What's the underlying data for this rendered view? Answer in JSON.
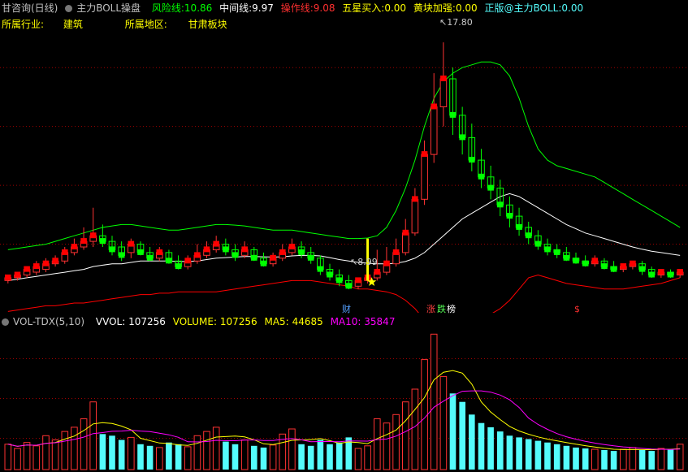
{
  "top_bar": {
    "stock": "甘咨询(日线)",
    "indicator": "主力BOLL操盘",
    "risk_label": "风险线:",
    "risk_value": "10.86",
    "mid_label": "中间线:",
    "mid_value": "9.97",
    "op_label": "操作线:",
    "op_value": "9.08",
    "five_label": "五星买入:",
    "five_value": "0.00",
    "yellow_label": "黄块加强:",
    "yellow_value": "0.00",
    "brand": "正版@主力BOLL:",
    "brand_value": "0.00"
  },
  "info_bar": {
    "industry_label": "所属行业:",
    "industry_value": "建筑",
    "region_label": "所属地区:",
    "region_value": "甘肃板块"
  },
  "annotations": {
    "high_label": "17.80",
    "low_label": "8.99",
    "markers": [
      "财",
      "涨",
      "跌",
      "榜",
      "$"
    ]
  },
  "volume_bar": {
    "name": "VOL-TDX(5,10)",
    "vvol_label": "VVOL:",
    "vvol_value": "107256",
    "volume_label": "VOLUME:",
    "volume_value": "107256",
    "ma5_label": "MA5:",
    "ma5_value": "44685",
    "ma10_label": "MA10:",
    "ma10_value": "35847"
  },
  "colors": {
    "up": "#ff3232",
    "down": "#54fcfc",
    "green": "#00ff00",
    "red": "#ff0000",
    "yellow": "#ffff00",
    "magenta": "#ff00ff",
    "white": "#ffffff",
    "grid": "#a00000"
  },
  "chart_data": {
    "type": "candlestick",
    "price_axis_range": [
      8.5,
      18.5
    ],
    "high": 17.8,
    "low": 8.99,
    "bars": [
      {
        "o": 9.3,
        "c": 9.4,
        "h": 9.5,
        "l": 9.2,
        "v": 30000
      },
      {
        "o": 9.4,
        "c": 9.5,
        "h": 9.6,
        "l": 9.3,
        "v": 25000
      },
      {
        "o": 9.5,
        "c": 9.7,
        "h": 9.8,
        "l": 9.4,
        "v": 32000
      },
      {
        "o": 9.6,
        "c": 9.8,
        "h": 10.0,
        "l": 9.5,
        "v": 28000
      },
      {
        "o": 9.7,
        "c": 9.9,
        "h": 10.1,
        "l": 9.6,
        "v": 40000
      },
      {
        "o": 9.9,
        "c": 10.0,
        "h": 10.2,
        "l": 9.8,
        "v": 35000
      },
      {
        "o": 10.0,
        "c": 10.3,
        "h": 10.5,
        "l": 9.9,
        "v": 45000
      },
      {
        "o": 10.3,
        "c": 10.5,
        "h": 10.8,
        "l": 10.2,
        "v": 50000
      },
      {
        "o": 10.5,
        "c": 10.7,
        "h": 11.2,
        "l": 10.4,
        "v": 60000
      },
      {
        "o": 10.7,
        "c": 10.9,
        "h": 11.9,
        "l": 10.5,
        "v": 80000
      },
      {
        "o": 10.9,
        "c": 10.7,
        "h": 11.3,
        "l": 10.5,
        "v": 42000
      },
      {
        "o": 10.7,
        "c": 10.4,
        "h": 10.9,
        "l": 10.2,
        "v": 40000
      },
      {
        "o": 10.5,
        "c": 10.2,
        "h": 10.7,
        "l": 10.0,
        "v": 35000
      },
      {
        "o": 10.3,
        "c": 10.6,
        "h": 10.8,
        "l": 10.1,
        "v": 38000
      },
      {
        "o": 10.6,
        "c": 10.3,
        "h": 10.7,
        "l": 10.2,
        "v": 30000
      },
      {
        "o": 10.3,
        "c": 10.1,
        "h": 10.5,
        "l": 10.0,
        "v": 28000
      },
      {
        "o": 10.1,
        "c": 10.3,
        "h": 10.5,
        "l": 10.0,
        "v": 26000
      },
      {
        "o": 10.3,
        "c": 10.0,
        "h": 10.4,
        "l": 9.9,
        "v": 32000
      },
      {
        "o": 10.0,
        "c": 9.8,
        "h": 10.2,
        "l": 9.7,
        "v": 30000
      },
      {
        "o": 9.8,
        "c": 10.0,
        "h": 10.2,
        "l": 9.7,
        "v": 27000
      },
      {
        "o": 10.0,
        "c": 10.2,
        "h": 10.6,
        "l": 9.9,
        "v": 40000
      },
      {
        "o": 10.2,
        "c": 10.4,
        "h": 10.7,
        "l": 10.1,
        "v": 45000
      },
      {
        "o": 10.4,
        "c": 10.6,
        "h": 10.9,
        "l": 10.3,
        "v": 50000
      },
      {
        "o": 10.6,
        "c": 10.4,
        "h": 10.8,
        "l": 10.2,
        "v": 33000
      },
      {
        "o": 10.4,
        "c": 10.2,
        "h": 10.6,
        "l": 10.0,
        "v": 30000
      },
      {
        "o": 10.2,
        "c": 10.4,
        "h": 10.7,
        "l": 10.1,
        "v": 35000
      },
      {
        "o": 10.4,
        "c": 10.1,
        "h": 10.5,
        "l": 10.0,
        "v": 28000
      },
      {
        "o": 10.1,
        "c": 9.9,
        "h": 10.3,
        "l": 9.8,
        "v": 26000
      },
      {
        "o": 9.9,
        "c": 10.1,
        "h": 10.3,
        "l": 9.8,
        "v": 29000
      },
      {
        "o": 10.1,
        "c": 10.3,
        "h": 10.6,
        "l": 10.0,
        "v": 42000
      },
      {
        "o": 10.3,
        "c": 10.5,
        "h": 10.8,
        "l": 10.2,
        "v": 48000
      },
      {
        "o": 10.5,
        "c": 10.3,
        "h": 10.7,
        "l": 10.1,
        "v": 30000
      },
      {
        "o": 10.3,
        "c": 10.1,
        "h": 10.5,
        "l": 9.9,
        "v": 28000
      },
      {
        "o": 10.1,
        "c": 9.7,
        "h": 10.2,
        "l": 9.5,
        "v": 35000
      },
      {
        "o": 9.7,
        "c": 9.5,
        "h": 9.9,
        "l": 9.3,
        "v": 30000
      },
      {
        "o": 9.5,
        "c": 9.3,
        "h": 9.7,
        "l": 9.1,
        "v": 32000
      },
      {
        "o": 9.3,
        "c": 9.1,
        "h": 9.5,
        "l": 8.99,
        "v": 38000
      },
      {
        "o": 9.1,
        "c": 9.3,
        "h": 9.4,
        "l": 9.0,
        "v": 25000
      },
      {
        "o": 9.3,
        "c": 9.4,
        "h": 9.6,
        "l": 9.2,
        "v": 28000
      },
      {
        "o": 9.4,
        "c": 9.6,
        "h": 10.4,
        "l": 9.3,
        "v": 60000
      },
      {
        "o": 9.6,
        "c": 9.9,
        "h": 10.5,
        "l": 9.5,
        "v": 55000
      },
      {
        "o": 9.9,
        "c": 10.3,
        "h": 10.8,
        "l": 9.8,
        "v": 65000
      },
      {
        "o": 10.3,
        "c": 11.0,
        "h": 11.5,
        "l": 10.2,
        "v": 80000
      },
      {
        "o": 11.0,
        "c": 12.2,
        "h": 12.6,
        "l": 10.9,
        "v": 95000
      },
      {
        "o": 12.2,
        "c": 13.8,
        "h": 14.3,
        "l": 12.0,
        "v": 130000
      },
      {
        "o": 13.8,
        "c": 15.5,
        "h": 16.7,
        "l": 13.5,
        "v": 160000
      },
      {
        "o": 15.5,
        "c": 16.5,
        "h": 17.8,
        "l": 14.8,
        "v": 110000
      },
      {
        "o": 16.5,
        "c": 15.2,
        "h": 16.9,
        "l": 14.5,
        "v": 90000
      },
      {
        "o": 15.2,
        "c": 14.4,
        "h": 15.5,
        "l": 13.8,
        "v": 80000
      },
      {
        "o": 14.4,
        "c": 13.6,
        "h": 14.9,
        "l": 13.2,
        "v": 65000
      },
      {
        "o": 13.6,
        "c": 13.0,
        "h": 14.0,
        "l": 12.6,
        "v": 55000
      },
      {
        "o": 13.0,
        "c": 12.6,
        "h": 13.4,
        "l": 12.2,
        "v": 50000
      },
      {
        "o": 12.6,
        "c": 12.0,
        "h": 12.9,
        "l": 11.6,
        "v": 45000
      },
      {
        "o": 12.0,
        "c": 11.6,
        "h": 12.3,
        "l": 11.2,
        "v": 40000
      },
      {
        "o": 11.6,
        "c": 11.2,
        "h": 11.9,
        "l": 10.9,
        "v": 38000
      },
      {
        "o": 11.2,
        "c": 10.9,
        "h": 11.4,
        "l": 10.6,
        "v": 36000
      },
      {
        "o": 10.9,
        "c": 10.6,
        "h": 11.1,
        "l": 10.4,
        "v": 34000
      },
      {
        "o": 10.6,
        "c": 10.4,
        "h": 10.8,
        "l": 10.2,
        "v": 32000
      },
      {
        "o": 10.4,
        "c": 10.3,
        "h": 10.6,
        "l": 10.1,
        "v": 30000
      },
      {
        "o": 10.3,
        "c": 10.1,
        "h": 10.5,
        "l": 10.0,
        "v": 28000
      },
      {
        "o": 10.1,
        "c": 10.0,
        "h": 10.3,
        "l": 9.9,
        "v": 26000
      },
      {
        "o": 10.0,
        "c": 9.9,
        "h": 10.2,
        "l": 9.8,
        "v": 25000
      },
      {
        "o": 9.9,
        "c": 10.0,
        "h": 10.2,
        "l": 9.8,
        "v": 24000
      },
      {
        "o": 10.0,
        "c": 9.8,
        "h": 10.1,
        "l": 9.7,
        "v": 23000
      },
      {
        "o": 9.8,
        "c": 9.7,
        "h": 10.0,
        "l": 9.6,
        "v": 22000
      },
      {
        "o": 9.7,
        "c": 9.8,
        "h": 9.9,
        "l": 9.6,
        "v": 24000
      },
      {
        "o": 9.8,
        "c": 9.9,
        "h": 10.0,
        "l": 9.7,
        "v": 26000
      },
      {
        "o": 9.9,
        "c": 9.7,
        "h": 10.0,
        "l": 9.5,
        "v": 23000
      },
      {
        "o": 9.7,
        "c": 9.5,
        "h": 9.8,
        "l": 9.4,
        "v": 22000
      },
      {
        "o": 9.5,
        "c": 9.6,
        "h": 9.7,
        "l": 9.4,
        "v": 25000
      },
      {
        "o": 9.6,
        "c": 9.5,
        "h": 9.7,
        "l": 9.4,
        "v": 24000
      },
      {
        "o": 9.5,
        "c": 9.6,
        "h": 9.7,
        "l": 9.4,
        "v": 30000
      }
    ],
    "upper_band": [
      10.4,
      10.45,
      10.5,
      10.55,
      10.6,
      10.7,
      10.8,
      10.9,
      11.0,
      11.1,
      11.2,
      11.25,
      11.3,
      11.3,
      11.25,
      11.2,
      11.15,
      11.1,
      11.1,
      11.15,
      11.2,
      11.25,
      11.3,
      11.3,
      11.28,
      11.25,
      11.2,
      11.15,
      11.1,
      11.1,
      11.1,
      11.05,
      11.0,
      10.95,
      10.9,
      10.85,
      10.8,
      10.8,
      10.82,
      10.9,
      11.2,
      11.8,
      12.6,
      13.6,
      14.8,
      15.8,
      16.4,
      16.7,
      16.9,
      17.0,
      17.1,
      17.1,
      17.0,
      16.6,
      15.8,
      14.8,
      14.0,
      13.6,
      13.4,
      13.3,
      13.2,
      13.1,
      13.0,
      12.8,
      12.6,
      12.4,
      12.2,
      12.0,
      11.8,
      11.6,
      11.4,
      11.2
    ],
    "mid_band": [
      9.3,
      9.35,
      9.4,
      9.45,
      9.5,
      9.55,
      9.6,
      9.65,
      9.7,
      9.8,
      9.85,
      9.9,
      9.9,
      9.95,
      10.0,
      10.0,
      10.0,
      10.0,
      9.98,
      9.98,
      10.0,
      10.05,
      10.1,
      10.12,
      10.14,
      10.16,
      10.16,
      10.15,
      10.14,
      10.15,
      10.18,
      10.2,
      10.2,
      10.18,
      10.12,
      10.05,
      10.0,
      9.95,
      9.92,
      9.9,
      9.9,
      9.92,
      9.98,
      10.1,
      10.3,
      10.6,
      10.9,
      11.2,
      11.5,
      11.7,
      11.9,
      12.1,
      12.3,
      12.4,
      12.3,
      12.1,
      11.9,
      11.7,
      11.5,
      11.3,
      11.15,
      11.0,
      10.9,
      10.8,
      10.7,
      10.6,
      10.5,
      10.42,
      10.35,
      10.3,
      10.25,
      10.2
    ],
    "lower_band": [
      8.2,
      8.25,
      8.3,
      8.35,
      8.4,
      8.4,
      8.45,
      8.5,
      8.5,
      8.55,
      8.6,
      8.65,
      8.7,
      8.75,
      8.8,
      8.8,
      8.85,
      8.85,
      8.9,
      8.9,
      8.9,
      8.9,
      8.9,
      8.95,
      9.0,
      9.05,
      9.1,
      9.15,
      9.2,
      9.25,
      9.3,
      9.3,
      9.3,
      9.25,
      9.2,
      9.15,
      9.1,
      9.0,
      9.0,
      8.95,
      8.9,
      8.8,
      8.6,
      8.3,
      7.9,
      7.5,
      7.3,
      7.35,
      7.5,
      7.7,
      7.9,
      8.1,
      8.3,
      8.6,
      9.0,
      9.4,
      9.5,
      9.4,
      9.3,
      9.2,
      9.15,
      9.1,
      9.05,
      9.0,
      9.0,
      9.0,
      9.05,
      9.1,
      9.15,
      9.2,
      9.3,
      9.4
    ]
  }
}
